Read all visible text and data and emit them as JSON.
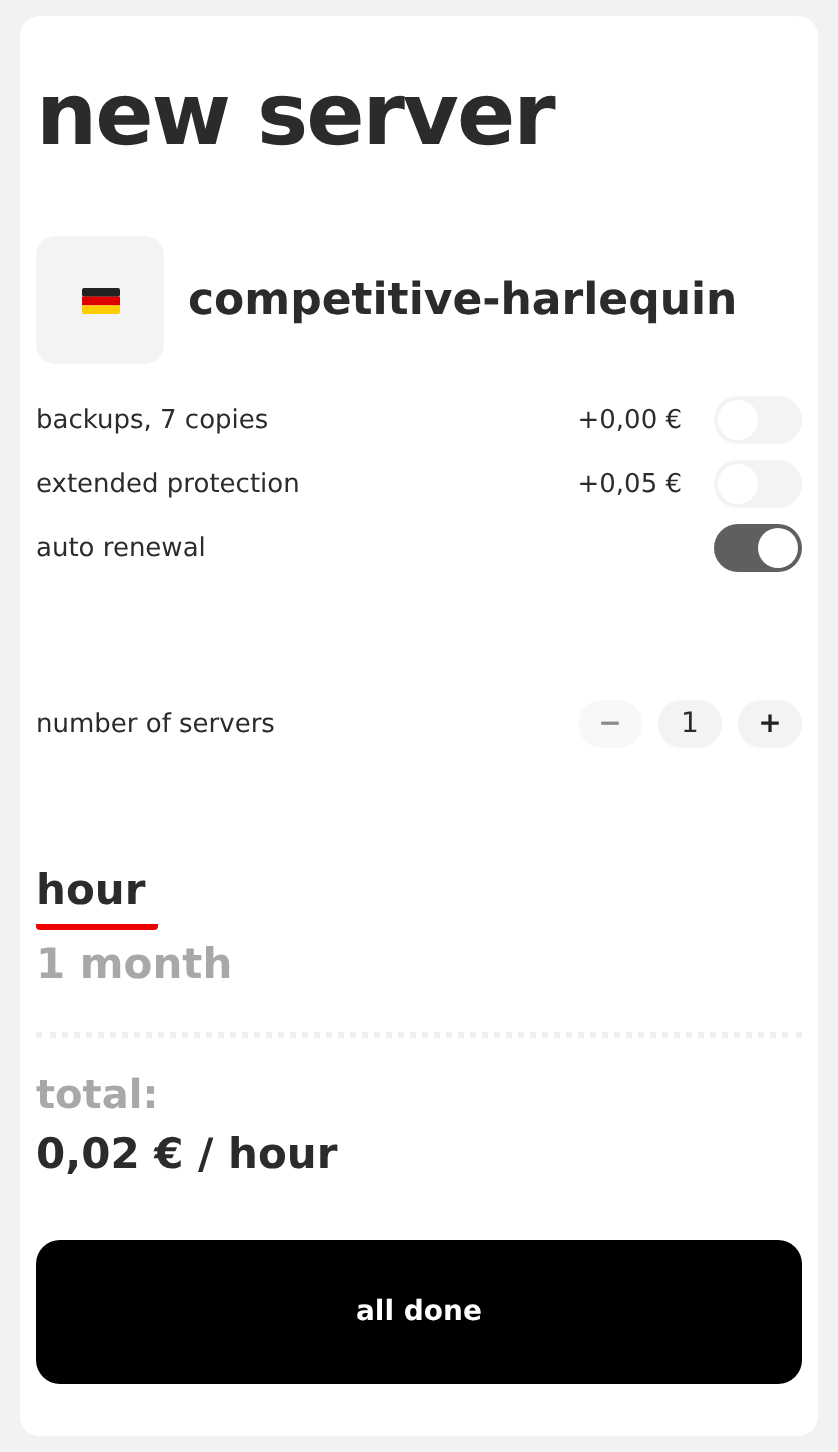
{
  "title": "new server",
  "server": {
    "name": "competitive-harlequin"
  },
  "options": [
    {
      "label": "backups, 7 copies",
      "price": "+0,00 €",
      "on": false
    },
    {
      "label": "extended protection",
      "price": "+0,05 €",
      "on": false
    },
    {
      "label": "auto renewal",
      "on": true
    }
  ],
  "counter": {
    "label": "number of servers",
    "minus": "−",
    "value": "1",
    "plus": "+",
    "minus_disabled": true
  },
  "periods": [
    {
      "label": "hour",
      "selected": true
    },
    {
      "label": "1 month",
      "selected": false
    }
  ],
  "total": {
    "label": "total:",
    "value": "0,02 € / hour"
  },
  "button": "all done"
}
